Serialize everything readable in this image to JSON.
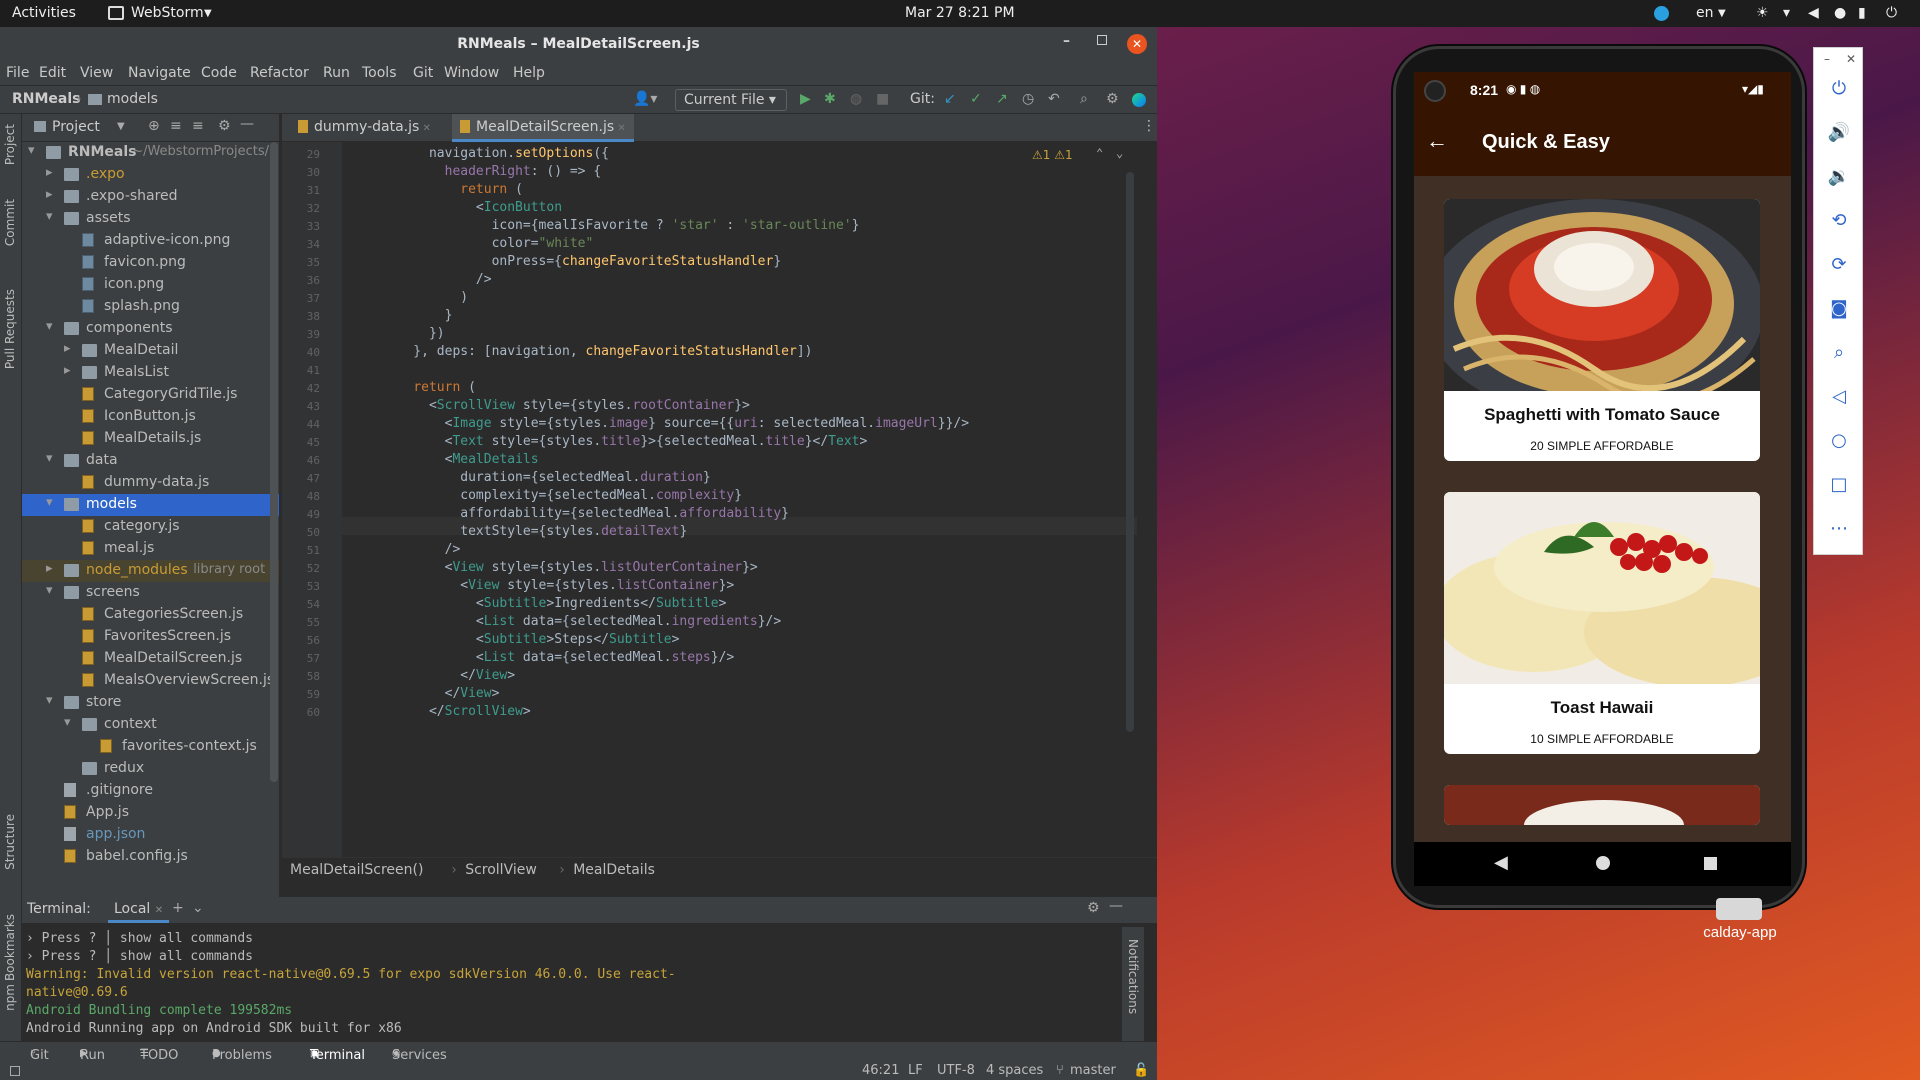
{
  "topbar": {
    "activities": "Activities",
    "app": "WebStorm",
    "datetime": "Mar 27  8:21 PM",
    "lang": "en"
  },
  "ide": {
    "title": "RNMeals – MealDetailScreen.js",
    "menu": [
      "File",
      "Edit",
      "View",
      "Navigate",
      "Code",
      "Refactor",
      "Run",
      "Tools",
      "Git",
      "Window",
      "Help"
    ],
    "breadcrumb": {
      "project": "RNMeals",
      "folder": "models"
    },
    "run_config": "Current File",
    "git_label": "Git:",
    "project_label": "Project",
    "tree": [
      {
        "label": "RNMeals",
        "suffix": " ~/WebstormProjects/",
        "depth": 0,
        "kind": "folder",
        "open": true
      },
      {
        "label": ".expo",
        "depth": 1,
        "kind": "folder",
        "open": false,
        "color": "#c99b35"
      },
      {
        "label": ".expo-shared",
        "depth": 1,
        "kind": "folder",
        "open": false
      },
      {
        "label": "assets",
        "depth": 1,
        "kind": "folder",
        "open": true
      },
      {
        "label": "adaptive-icon.png",
        "depth": 2,
        "kind": "png"
      },
      {
        "label": "favicon.png",
        "depth": 2,
        "kind": "png"
      },
      {
        "label": "icon.png",
        "depth": 2,
        "kind": "png"
      },
      {
        "label": "splash.png",
        "depth": 2,
        "kind": "png"
      },
      {
        "label": "components",
        "depth": 1,
        "kind": "folder",
        "open": true
      },
      {
        "label": "MealDetail",
        "depth": 2,
        "kind": "folder",
        "open": false
      },
      {
        "label": "MealsList",
        "depth": 2,
        "kind": "folder",
        "open": false
      },
      {
        "label": "CategoryGridTile.js",
        "depth": 2,
        "kind": "js"
      },
      {
        "label": "IconButton.js",
        "depth": 2,
        "kind": "js"
      },
      {
        "label": "MealDetails.js",
        "depth": 2,
        "kind": "js"
      },
      {
        "label": "data",
        "depth": 1,
        "kind": "folder",
        "open": true
      },
      {
        "label": "dummy-data.js",
        "depth": 2,
        "kind": "js"
      },
      {
        "label": "models",
        "depth": 1,
        "kind": "folder",
        "open": true,
        "selected": true
      },
      {
        "label": "category.js",
        "depth": 2,
        "kind": "js"
      },
      {
        "label": "meal.js",
        "depth": 2,
        "kind": "js"
      },
      {
        "label": "node_modules",
        "suffix": " library root",
        "depth": 1,
        "kind": "folder",
        "open": false,
        "color": "#c99b35",
        "shaded": true
      },
      {
        "label": "screens",
        "depth": 1,
        "kind": "folder",
        "open": true
      },
      {
        "label": "CategoriesScreen.js",
        "depth": 2,
        "kind": "js"
      },
      {
        "label": "FavoritesScreen.js",
        "depth": 2,
        "kind": "js"
      },
      {
        "label": "MealDetailScreen.js",
        "depth": 2,
        "kind": "js"
      },
      {
        "label": "MealsOverviewScreen.js",
        "depth": 2,
        "kind": "js"
      },
      {
        "label": "store",
        "depth": 1,
        "kind": "folder",
        "open": true
      },
      {
        "label": "context",
        "depth": 2,
        "kind": "folder",
        "open": true
      },
      {
        "label": "favorites-context.js",
        "depth": 3,
        "kind": "js"
      },
      {
        "label": "redux",
        "depth": 2,
        "kind": "folder",
        "open": false,
        "noarrow": true
      },
      {
        "label": ".gitignore",
        "depth": 1,
        "kind": "txt",
        "noarrow": true
      },
      {
        "label": "App.js",
        "depth": 1,
        "kind": "js",
        "noarrow": true
      },
      {
        "label": "app.json",
        "depth": 1,
        "kind": "txt",
        "noarrow": true,
        "color": "#6897bb"
      },
      {
        "label": "babel.config.js",
        "depth": 1,
        "kind": "js",
        "noarrow": true
      }
    ],
    "tabs": [
      {
        "label": "dummy-data.js",
        "active": false
      },
      {
        "label": "MealDetailScreen.js",
        "active": true
      }
    ],
    "warnings": "⚠1  ⚠1",
    "code": [
      {
        "n": "29",
        "t": "      navigation.setOptions({"
      },
      {
        "n": "30",
        "t": "        headerRight: () => {"
      },
      {
        "n": "31",
        "t": "          return ("
      },
      {
        "n": "32",
        "t": "            <IconButton"
      },
      {
        "n": "33",
        "t": "              icon={mealIsFavorite ? 'star' : 'star-outline'}"
      },
      {
        "n": "34",
        "t": "              color=\"white\""
      },
      {
        "n": "35",
        "t": "              onPress={changeFavoriteStatusHandler}"
      },
      {
        "n": "36",
        "t": "            />"
      },
      {
        "n": "37",
        "t": "          )"
      },
      {
        "n": "38",
        "t": "        }"
      },
      {
        "n": "39",
        "t": "      })"
      },
      {
        "n": "40",
        "t": "    }, deps: [navigation, changeFavoriteStatusHandler])"
      },
      {
        "n": "41",
        "t": ""
      },
      {
        "n": "42",
        "t": "    return ("
      },
      {
        "n": "43",
        "t": "      <ScrollView style={styles.rootContainer}>"
      },
      {
        "n": "44",
        "t": "        <Image style={styles.image} source={{uri: selectedMeal.imageUrl}}/>"
      },
      {
        "n": "45",
        "t": "        <Text style={styles.title}>{selectedMeal.title}</Text>"
      },
      {
        "n": "46",
        "t": "        <MealDetails"
      },
      {
        "n": "47",
        "t": "          duration={selectedMeal.duration}"
      },
      {
        "n": "48",
        "t": "          complexity={selectedMeal.complexity}"
      },
      {
        "n": "49",
        "t": "          affordability={selectedMeal.affordability}"
      },
      {
        "n": "50",
        "t": "          textStyle={styles.detailText}"
      },
      {
        "n": "51",
        "t": "        />"
      },
      {
        "n": "52",
        "t": "        <View style={styles.listOuterContainer}>"
      },
      {
        "n": "53",
        "t": "          <View style={styles.listContainer}>"
      },
      {
        "n": "54",
        "t": "            <Subtitle>Ingredients</Subtitle>"
      },
      {
        "n": "55",
        "t": "            <List data={selectedMeal.ingredients}/>"
      },
      {
        "n": "56",
        "t": "            <Subtitle>Steps</Subtitle>"
      },
      {
        "n": "57",
        "t": "            <List data={selectedMeal.steps}/>"
      },
      {
        "n": "58",
        "t": "          </View>"
      },
      {
        "n": "59",
        "t": "        </View>"
      },
      {
        "n": "60",
        "t": "      </ScrollView>"
      }
    ],
    "editor_crumbs": [
      "MealDetailScreen()",
      "ScrollView",
      "MealDetails"
    ],
    "terminal": {
      "label": "Terminal:",
      "tab": "Local",
      "lines": [
        {
          "t": "› Press ? │ show all commands",
          "c": "#bbbbbb"
        },
        {
          "t": "› Press ? │ show all commands",
          "c": "#bbbbbb"
        },
        {
          "t": "Warning: Invalid version react-native@0.69.5 for expo sdkVersion 46.0.0. Use react-",
          "c": "#c7a43a"
        },
        {
          "t": "native@0.69.6",
          "c": "#c7a43a"
        },
        {
          "t": "Android Bundling complete 199582ms",
          "c": "#59a869"
        },
        {
          "t": "Android Running app on Android SDK built for x86",
          "c": "#bbbbbb"
        }
      ]
    },
    "bottom_tools": [
      "Git",
      "Run",
      "TODO",
      "Problems",
      "Terminal",
      "Services"
    ],
    "status": {
      "pos": "46:21",
      "eol": "LF",
      "enc": "UTF-8",
      "indent": "4 spaces",
      "branch": "master"
    },
    "side_tools": [
      "Project",
      "Commit",
      "Pull Requests",
      "Structure",
      "Bookmarks",
      "npm"
    ],
    "notifications": "Notifications"
  },
  "phone": {
    "time": "8:21",
    "header": "Quick & Easy",
    "meals": [
      {
        "title": "Spaghetti with Tomato Sauce",
        "details": "20  SIMPLE  AFFORDABLE"
      },
      {
        "title": "Toast Hawaii",
        "details": "10  SIMPLE  AFFORDABLE"
      }
    ]
  },
  "desktop_icon": "calday-app",
  "colors": {
    "accent": "#2f65ca",
    "app_header": "#351401",
    "app_bg": "#3f2f25"
  }
}
